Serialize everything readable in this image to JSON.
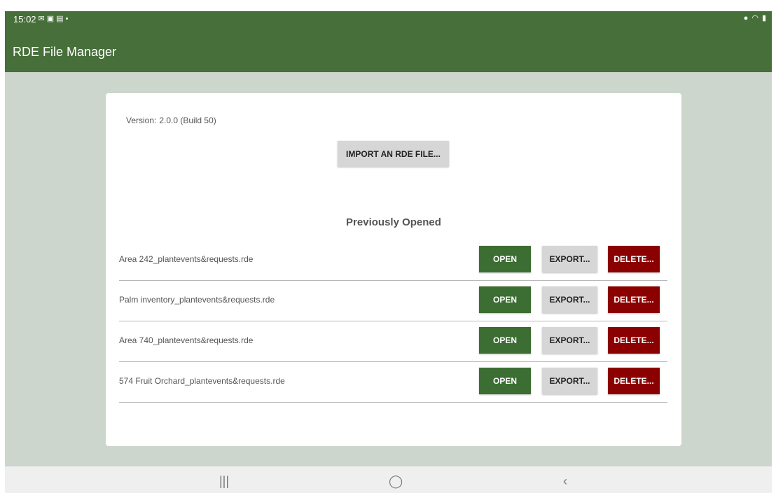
{
  "status_bar": {
    "time": "15:02",
    "left_icons": [
      "mail-icon",
      "calendar-icon",
      "gallery-icon",
      "dot-icon"
    ],
    "right_icons": [
      "location-icon",
      "wifi-icon",
      "battery-icon"
    ]
  },
  "app": {
    "title": "RDE File Manager"
  },
  "version": {
    "label": "Version:",
    "value": "2.0.0 (Build 50)"
  },
  "import_label": "IMPORT AN RDE FILE...",
  "section_title": "Previously Opened",
  "files": [
    {
      "name": "Area 242_plantevents&requests.rde"
    },
    {
      "name": "Palm inventory_plantevents&requests.rde"
    },
    {
      "name": "Area 740_plantevents&requests.rde"
    },
    {
      "name": "574 Fruit Orchard_plantevents&requests.rde"
    }
  ],
  "actions": {
    "open": "OPEN",
    "export": "EXPORT...",
    "delete": "DELETE..."
  },
  "nav": {
    "recents": "|||",
    "home": "◯",
    "back": "‹"
  },
  "colors": {
    "header": "#466f39",
    "background": "#ccd6cd",
    "open_button": "#3c6d32",
    "export_button": "#d6d6d6",
    "delete_button": "#8b0000"
  }
}
